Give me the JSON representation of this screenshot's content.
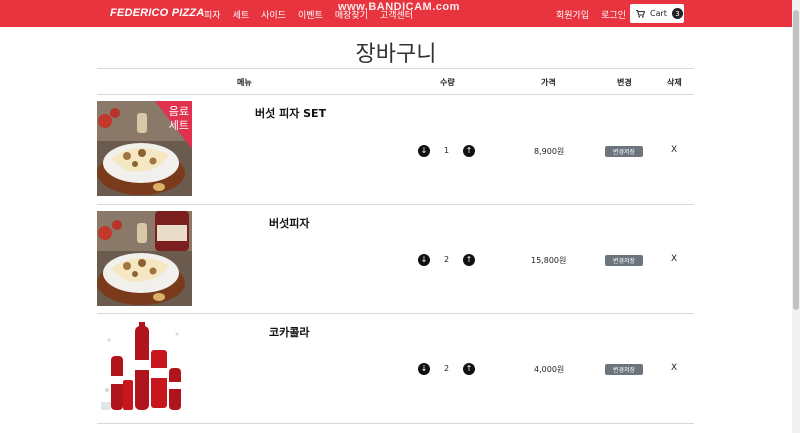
{
  "nav": {
    "brand": "FEDERICO PIZZA",
    "links": [
      "피자",
      "세트",
      "사이드",
      "이벤트",
      "매장찾기",
      "고객센터"
    ],
    "watermark": "www.BANDICAM.com",
    "signup": "회원가입",
    "login": "로그인",
    "cart_label": "Cart",
    "cart_count": "3"
  },
  "page": {
    "title": "장바구니"
  },
  "table": {
    "headers": {
      "menu": "메뉴",
      "qty": "수량",
      "price": "가격",
      "change": "변경",
      "delete": "삭제"
    }
  },
  "items": [
    {
      "name": "버섯 피자 SET",
      "badge": "음료\n세트",
      "qty": "1",
      "price": "8,900원",
      "save_label": "변경저장",
      "delete_label": "X"
    },
    {
      "name": "버섯피자",
      "qty": "2",
      "price": "15,800원",
      "save_label": "변경저장",
      "delete_label": "X"
    },
    {
      "name": "코카콜라",
      "qty": "2",
      "price": "4,000원",
      "save_label": "변경저장",
      "delete_label": "X"
    }
  ],
  "colors": {
    "navbar": "#e8343f",
    "save_button": "#6c757d"
  },
  "icons": {
    "decrease": "arrow-down-circle-icon",
    "increase": "arrow-up-circle-icon",
    "cart": "cart-icon"
  }
}
